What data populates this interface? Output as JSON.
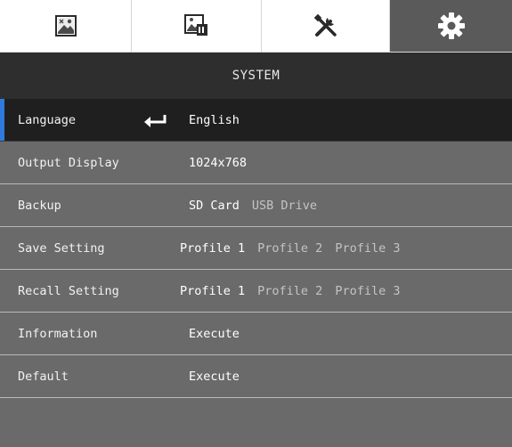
{
  "tabs": [
    {
      "icon": "picture-icon",
      "active": false
    },
    {
      "icon": "image-edit-icon",
      "active": false
    },
    {
      "icon": "tools-icon",
      "active": false
    },
    {
      "icon": "gear-icon",
      "active": true
    }
  ],
  "title": "SYSTEM",
  "rows": [
    {
      "label": "Language",
      "selected": true,
      "options": [
        {
          "text": "English"
        }
      ]
    },
    {
      "label": "Output Display",
      "options": [
        {
          "text": "1024x768"
        }
      ]
    },
    {
      "label": "Backup",
      "options": [
        {
          "text": "SD Card"
        },
        {
          "text": "USB Drive"
        }
      ]
    },
    {
      "label": "Save Setting",
      "options": [
        {
          "text": "Profile 1"
        },
        {
          "text": "Profile 2"
        },
        {
          "text": "Profile 3"
        }
      ]
    },
    {
      "label": "Recall Setting",
      "options": [
        {
          "text": "Profile 1"
        },
        {
          "text": "Profile 2"
        },
        {
          "text": "Profile 3"
        }
      ]
    },
    {
      "label": "Information",
      "options": [
        {
          "text": "Execute"
        }
      ]
    },
    {
      "label": "Default",
      "options": [
        {
          "text": "Execute"
        }
      ]
    }
  ],
  "colors": {
    "selection_marker": "#2f7bdc",
    "title_bar": "#2e2e2e",
    "menu_bg": "#6a6a6a"
  }
}
